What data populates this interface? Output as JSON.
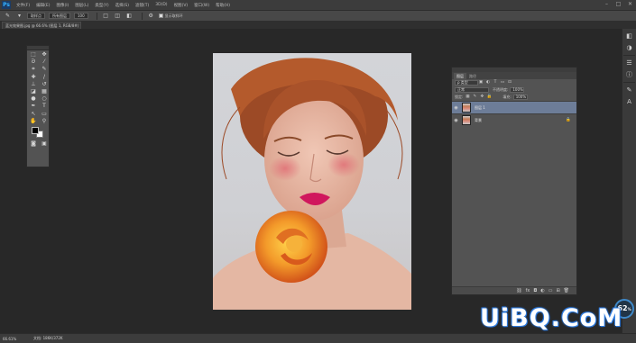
{
  "app": {
    "logo": "Ps"
  },
  "menu": [
    "文件(F)",
    "编辑(E)",
    "图像(I)",
    "图层(L)",
    "类型(Y)",
    "选择(S)",
    "滤镜(T)",
    "3D(D)",
    "视图(V)",
    "窗口(W)",
    "帮助(H)"
  ],
  "options_bar": {
    "sample_size": "取样点",
    "sample": "所有图层",
    "show_ring": "显示取样环",
    "brush_size": "100"
  },
  "document_tab": "蓝光效果图.jpg @ 66.6% (图层 1, RGB/8#) *",
  "layers_panel": {
    "tabs": [
      "图层",
      "路径"
    ],
    "kind_filter": "ρ 类型",
    "blend_mode": "正常",
    "opacity_label": "不透明度:",
    "opacity_value": "100%",
    "lock_label": "锁定:",
    "fill_label": "填充:",
    "fill_value": "100%",
    "layers": [
      {
        "name": "图层 1",
        "selected": true,
        "locked": false
      },
      {
        "name": "背景",
        "selected": false,
        "locked": true
      }
    ],
    "bottom_icons": [
      "link-icon",
      "fx-icon",
      "mask-icon",
      "adjustment-icon",
      "folder-icon",
      "new-layer-icon",
      "trash-icon"
    ]
  },
  "status_bar": {
    "zoom": "66.61%",
    "doc": "文档: 186K/372K"
  },
  "performance": {
    "value": "62",
    "unit": "%"
  },
  "watermark": "UiBQ.CoM",
  "colors": {
    "accent_selected_layer": "#6d7d98",
    "ps_logo_bg": "#1c3c66",
    "ps_logo_fg": "#35b2ff",
    "watermark_outline": "#2d7be0"
  }
}
